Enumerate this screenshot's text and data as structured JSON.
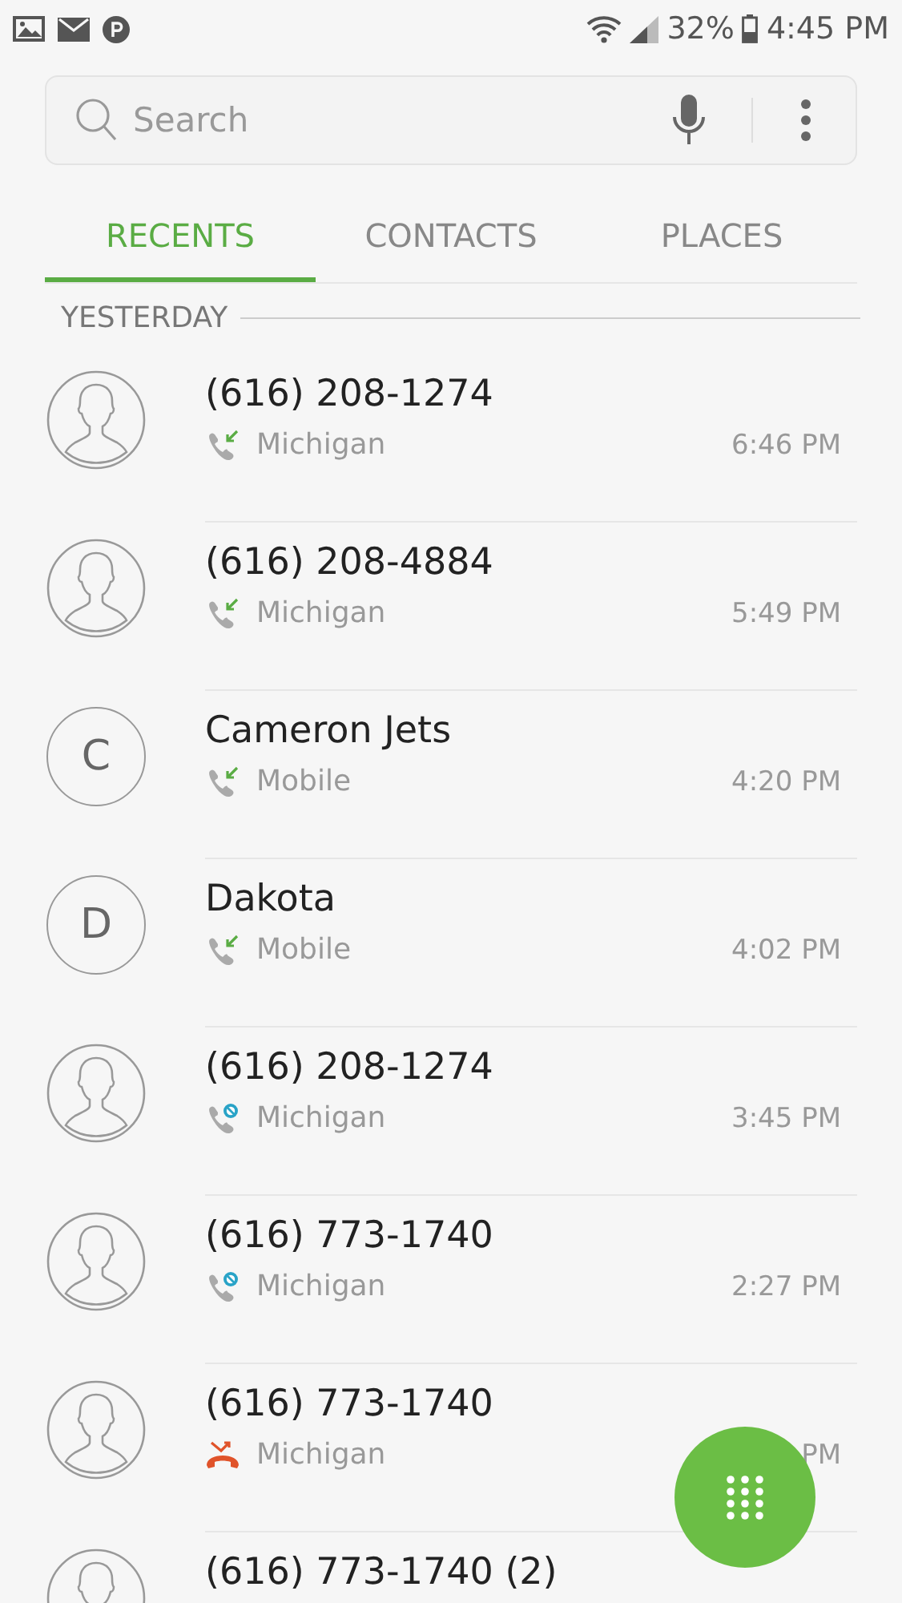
{
  "status_bar": {
    "battery": "32%",
    "time": "4:45 PM"
  },
  "search": {
    "placeholder": "Search"
  },
  "tabs": [
    {
      "label": "RECENTS",
      "selected": true
    },
    {
      "label": "CONTACTS",
      "selected": false
    },
    {
      "label": "PLACES",
      "selected": false
    }
  ],
  "section": "YESTERDAY",
  "calls": [
    {
      "avatar": {
        "kind": "person"
      },
      "name": "(616) 208-1274",
      "kind": "incoming",
      "location": "Michigan",
      "time": "6:46 PM"
    },
    {
      "avatar": {
        "kind": "person"
      },
      "name": "(616) 208-4884",
      "kind": "incoming",
      "location": "Michigan",
      "time": "5:49 PM"
    },
    {
      "avatar": {
        "kind": "letter",
        "initial": "C"
      },
      "name": "Cameron Jets",
      "kind": "incoming",
      "location": "Mobile",
      "time": "4:20 PM"
    },
    {
      "avatar": {
        "kind": "letter",
        "initial": "D"
      },
      "name": "Dakota",
      "kind": "incoming",
      "location": "Mobile",
      "time": "4:02 PM"
    },
    {
      "avatar": {
        "kind": "person"
      },
      "name": "(616) 208-1274",
      "kind": "blocked",
      "location": "Michigan",
      "time": "3:45 PM"
    },
    {
      "avatar": {
        "kind": "person"
      },
      "name": "(616) 773-1740",
      "kind": "blocked",
      "location": "Michigan",
      "time": "2:27 PM"
    },
    {
      "avatar": {
        "kind": "person"
      },
      "name": "(616) 773-1740",
      "kind": "missed",
      "location": "Michigan",
      "time": "PM"
    },
    {
      "avatar": {
        "kind": "person"
      },
      "name": "(616) 773-1740 (2)"
    }
  ]
}
